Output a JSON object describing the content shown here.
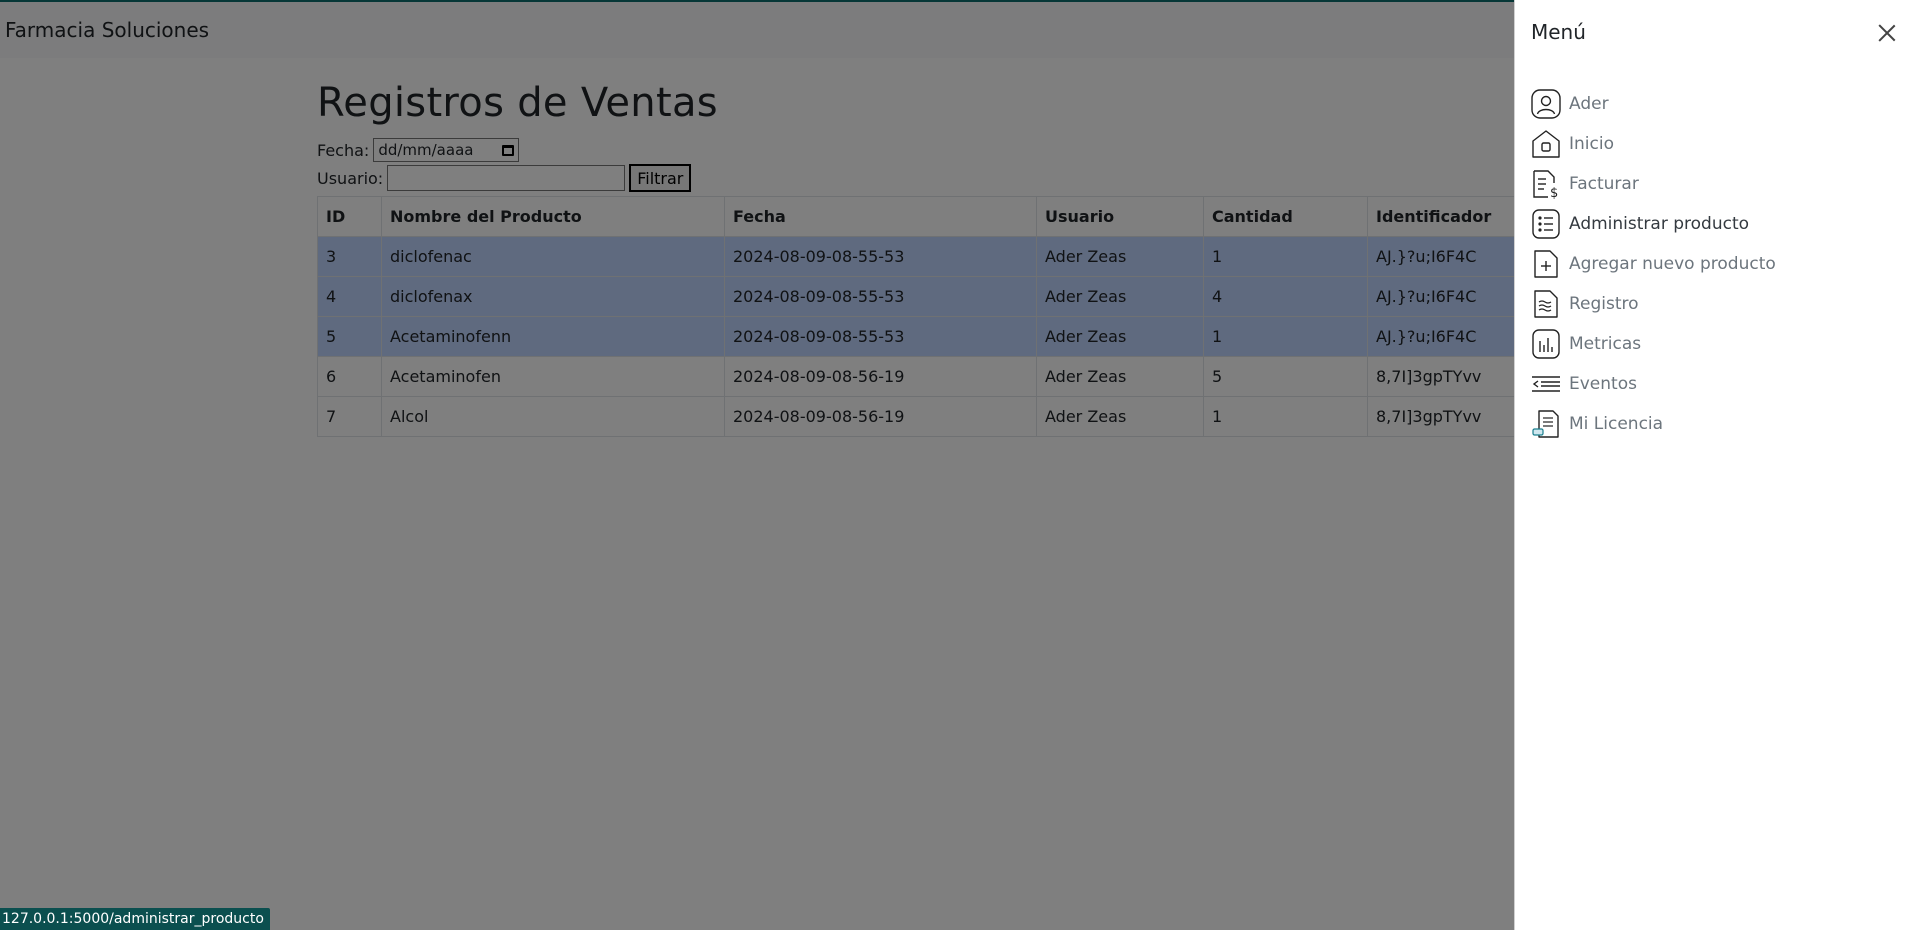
{
  "app": {
    "brand": "Farmacia Soluciones"
  },
  "page": {
    "title": "Registros de Ventas",
    "filters": {
      "date_label": "Fecha:",
      "date_placeholder": "dd/mm/aaaa",
      "user_label": "Usuario:",
      "user_value": "",
      "filter_button": "Filtrar"
    },
    "table": {
      "columns": [
        "ID",
        "Nombre del Producto",
        "Fecha",
        "Usuario",
        "Cantidad",
        "Identificador"
      ],
      "rows": [
        {
          "id": "3",
          "product": "diclofenac",
          "date": "2024-08-09-08-55-53",
          "user": "Ader Zeas",
          "qty": "1",
          "ident": "AJ.}?u;I6F4C",
          "selected": true
        },
        {
          "id": "4",
          "product": "diclofenax",
          "date": "2024-08-09-08-55-53",
          "user": "Ader Zeas",
          "qty": "4",
          "ident": "AJ.}?u;I6F4C",
          "selected": true
        },
        {
          "id": "5",
          "product": "Acetaminofenn",
          "date": "2024-08-09-08-55-53",
          "user": "Ader Zeas",
          "qty": "1",
          "ident": "AJ.}?u;I6F4C",
          "selected": true
        },
        {
          "id": "6",
          "product": "Acetaminofen",
          "date": "2024-08-09-08-56-19",
          "user": "Ader Zeas",
          "qty": "5",
          "ident": "8,7I]3gpTYvv",
          "selected": false
        },
        {
          "id": "7",
          "product": "Alcol",
          "date": "2024-08-09-08-56-19",
          "user": "Ader Zeas",
          "qty": "1",
          "ident": "8,7I]3gpTYvv",
          "selected": false
        }
      ]
    }
  },
  "offcanvas": {
    "title": "Menú",
    "items": [
      {
        "label": "Ader",
        "icon": "user-icon",
        "active": false
      },
      {
        "label": "Inicio",
        "icon": "home-icon",
        "active": false
      },
      {
        "label": "Facturar",
        "icon": "invoice-dollar-icon",
        "active": false
      },
      {
        "label": "Administrar producto",
        "icon": "list-icon",
        "active": true
      },
      {
        "label": "Agregar nuevo producto",
        "icon": "file-plus-icon",
        "active": false
      },
      {
        "label": "Registro",
        "icon": "file-text-icon",
        "active": false
      },
      {
        "label": "Metricas",
        "icon": "bar-chart-icon",
        "active": false
      },
      {
        "label": "Eventos",
        "icon": "events-list-icon",
        "active": false
      },
      {
        "label": "Mi Licencia",
        "icon": "license-icon",
        "active": false
      }
    ]
  },
  "status_bar": {
    "url": "127.0.0.1:5000/administrar_producto"
  },
  "colors": {
    "accent": "#0d6e6e",
    "selected_row": "#bfd4ff",
    "overlay": "rgba(0,0,0,0.5)"
  }
}
